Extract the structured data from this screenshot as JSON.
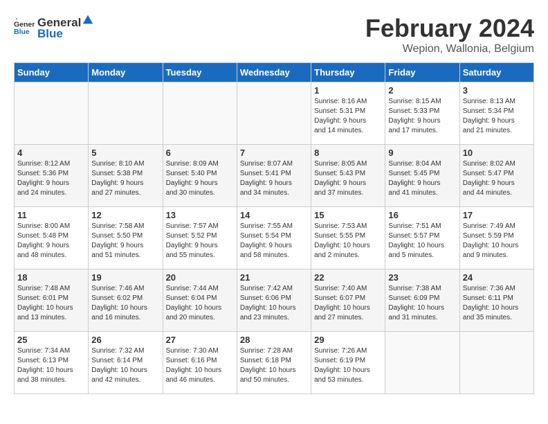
{
  "logo": {
    "general": "General",
    "blue": "Blue"
  },
  "title": "February 2024",
  "location": "Wepion, Wallonia, Belgium",
  "days_of_week": [
    "Sunday",
    "Monday",
    "Tuesday",
    "Wednesday",
    "Thursday",
    "Friday",
    "Saturday"
  ],
  "weeks": [
    [
      {
        "day": "",
        "info": ""
      },
      {
        "day": "",
        "info": ""
      },
      {
        "day": "",
        "info": ""
      },
      {
        "day": "",
        "info": ""
      },
      {
        "day": "1",
        "info": "Sunrise: 8:16 AM\nSunset: 5:31 PM\nDaylight: 9 hours\nand 14 minutes."
      },
      {
        "day": "2",
        "info": "Sunrise: 8:15 AM\nSunset: 5:33 PM\nDaylight: 9 hours\nand 17 minutes."
      },
      {
        "day": "3",
        "info": "Sunrise: 8:13 AM\nSunset: 5:34 PM\nDaylight: 9 hours\nand 21 minutes."
      }
    ],
    [
      {
        "day": "4",
        "info": "Sunrise: 8:12 AM\nSunset: 5:36 PM\nDaylight: 9 hours\nand 24 minutes."
      },
      {
        "day": "5",
        "info": "Sunrise: 8:10 AM\nSunset: 5:38 PM\nDaylight: 9 hours\nand 27 minutes."
      },
      {
        "day": "6",
        "info": "Sunrise: 8:09 AM\nSunset: 5:40 PM\nDaylight: 9 hours\nand 30 minutes."
      },
      {
        "day": "7",
        "info": "Sunrise: 8:07 AM\nSunset: 5:41 PM\nDaylight: 9 hours\nand 34 minutes."
      },
      {
        "day": "8",
        "info": "Sunrise: 8:05 AM\nSunset: 5:43 PM\nDaylight: 9 hours\nand 37 minutes."
      },
      {
        "day": "9",
        "info": "Sunrise: 8:04 AM\nSunset: 5:45 PM\nDaylight: 9 hours\nand 41 minutes."
      },
      {
        "day": "10",
        "info": "Sunrise: 8:02 AM\nSunset: 5:47 PM\nDaylight: 9 hours\nand 44 minutes."
      }
    ],
    [
      {
        "day": "11",
        "info": "Sunrise: 8:00 AM\nSunset: 5:48 PM\nDaylight: 9 hours\nand 48 minutes."
      },
      {
        "day": "12",
        "info": "Sunrise: 7:58 AM\nSunset: 5:50 PM\nDaylight: 9 hours\nand 51 minutes."
      },
      {
        "day": "13",
        "info": "Sunrise: 7:57 AM\nSunset: 5:52 PM\nDaylight: 9 hours\nand 55 minutes."
      },
      {
        "day": "14",
        "info": "Sunrise: 7:55 AM\nSunset: 5:54 PM\nDaylight: 9 hours\nand 58 minutes."
      },
      {
        "day": "15",
        "info": "Sunrise: 7:53 AM\nSunset: 5:55 PM\nDaylight: 10 hours\nand 2 minutes."
      },
      {
        "day": "16",
        "info": "Sunrise: 7:51 AM\nSunset: 5:57 PM\nDaylight: 10 hours\nand 5 minutes."
      },
      {
        "day": "17",
        "info": "Sunrise: 7:49 AM\nSunset: 5:59 PM\nDaylight: 10 hours\nand 9 minutes."
      }
    ],
    [
      {
        "day": "18",
        "info": "Sunrise: 7:48 AM\nSunset: 6:01 PM\nDaylight: 10 hours\nand 13 minutes."
      },
      {
        "day": "19",
        "info": "Sunrise: 7:46 AM\nSunset: 6:02 PM\nDaylight: 10 hours\nand 16 minutes."
      },
      {
        "day": "20",
        "info": "Sunrise: 7:44 AM\nSunset: 6:04 PM\nDaylight: 10 hours\nand 20 minutes."
      },
      {
        "day": "21",
        "info": "Sunrise: 7:42 AM\nSunset: 6:06 PM\nDaylight: 10 hours\nand 23 minutes."
      },
      {
        "day": "22",
        "info": "Sunrise: 7:40 AM\nSunset: 6:07 PM\nDaylight: 10 hours\nand 27 minutes."
      },
      {
        "day": "23",
        "info": "Sunrise: 7:38 AM\nSunset: 6:09 PM\nDaylight: 10 hours\nand 31 minutes."
      },
      {
        "day": "24",
        "info": "Sunrise: 7:36 AM\nSunset: 6:11 PM\nDaylight: 10 hours\nand 35 minutes."
      }
    ],
    [
      {
        "day": "25",
        "info": "Sunrise: 7:34 AM\nSunset: 6:13 PM\nDaylight: 10 hours\nand 38 minutes."
      },
      {
        "day": "26",
        "info": "Sunrise: 7:32 AM\nSunset: 6:14 PM\nDaylight: 10 hours\nand 42 minutes."
      },
      {
        "day": "27",
        "info": "Sunrise: 7:30 AM\nSunset: 6:16 PM\nDaylight: 10 hours\nand 46 minutes."
      },
      {
        "day": "28",
        "info": "Sunrise: 7:28 AM\nSunset: 6:18 PM\nDaylight: 10 hours\nand 50 minutes."
      },
      {
        "day": "29",
        "info": "Sunrise: 7:26 AM\nSunset: 6:19 PM\nDaylight: 10 hours\nand 53 minutes."
      },
      {
        "day": "",
        "info": ""
      },
      {
        "day": "",
        "info": ""
      }
    ]
  ]
}
